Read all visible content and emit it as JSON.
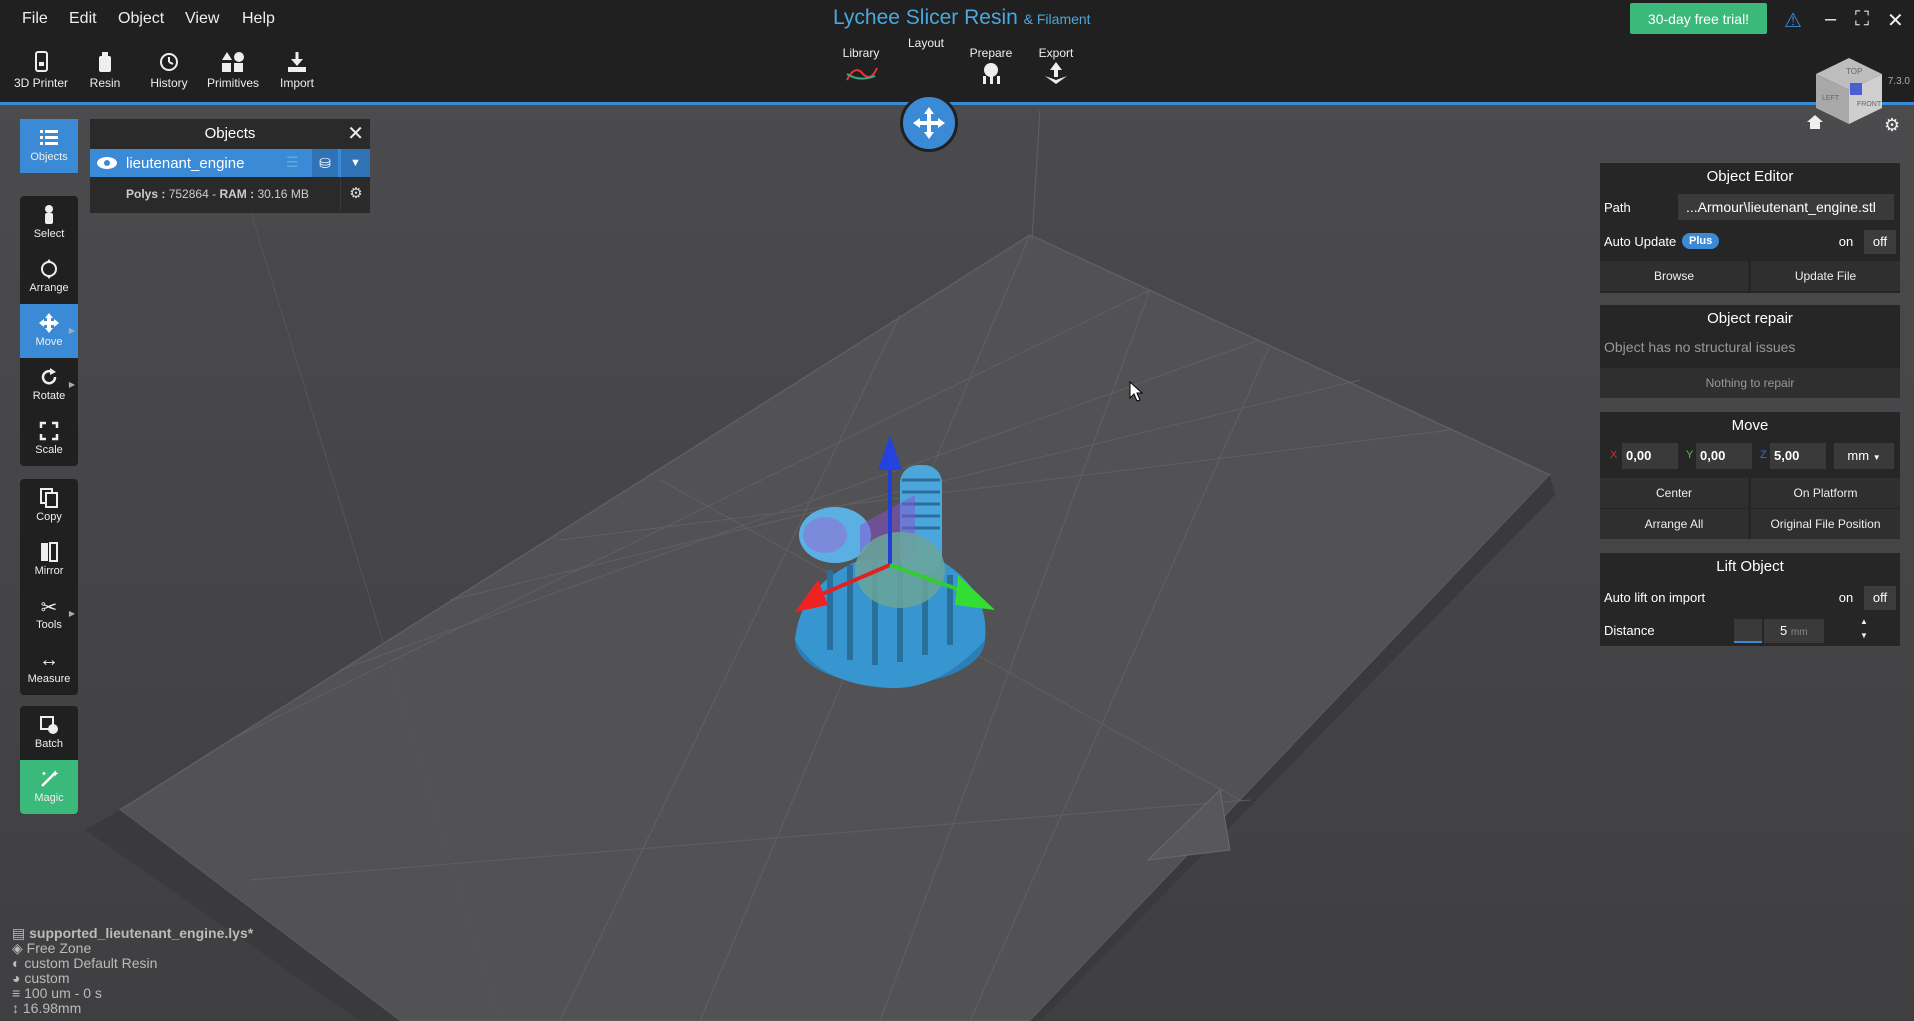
{
  "menu": [
    "File",
    "Edit",
    "Object",
    "View",
    "Help"
  ],
  "app": {
    "title": "Lychee Slicer Resin",
    "subtitle": "& Filament",
    "trial": "30-day free trial!",
    "version": "7.3.0"
  },
  "toolbar_left": [
    {
      "label": "3D Printer",
      "icon": "printer-icon"
    },
    {
      "label": "Resin",
      "icon": "resin-bottle-icon"
    },
    {
      "label": "History",
      "icon": "history-icon"
    },
    {
      "label": "Primitives",
      "icon": "shapes-icon"
    },
    {
      "label": "Import",
      "icon": "import-icon"
    }
  ],
  "workflow_tabs": [
    {
      "label": "Library",
      "icon": "library-icon"
    },
    {
      "label": "Layout",
      "icon": "move-arrows-icon",
      "active": true
    },
    {
      "label": "Prepare",
      "icon": "supports-icon"
    },
    {
      "label": "Export",
      "icon": "export-icon"
    }
  ],
  "view_cube": {
    "top": "TOP",
    "left": "LEFT",
    "front": "FRONT"
  },
  "rail": [
    [
      {
        "label": "Objects",
        "icon": "list-icon",
        "active": true
      }
    ],
    [
      {
        "label": "Select",
        "icon": "pointer-icon"
      },
      {
        "label": "Arrange",
        "icon": "arrange-icon"
      },
      {
        "label": "Move",
        "icon": "move-icon",
        "active": true
      },
      {
        "label": "Rotate",
        "icon": "rotate-icon"
      },
      {
        "label": "Scale",
        "icon": "scale-icon"
      }
    ],
    [
      {
        "label": "Copy",
        "icon": "copy-icon"
      },
      {
        "label": "Mirror",
        "icon": "mirror-icon"
      },
      {
        "label": "Tools",
        "icon": "scissors-icon"
      },
      {
        "label": "Measure",
        "icon": "measure-icon"
      }
    ],
    [
      {
        "label": "Batch",
        "icon": "batch-icon"
      },
      {
        "label": "Magic",
        "icon": "magic-wand-icon"
      }
    ]
  ],
  "objects_panel": {
    "title": "Objects",
    "object_name": "lieutenant_engine",
    "polys_label": "Polys :",
    "polys_value": "752864",
    "sep": "-",
    "ram_label": "RAM :",
    "ram_value": "30.16 MB"
  },
  "object_editor": {
    "title": "Object Editor",
    "path_label": "Path",
    "path_value": "...Armour\\lieutenant_engine.stl",
    "auto_update_label": "Auto Update",
    "plus_badge": "Plus",
    "on": "on",
    "off": "off",
    "browse": "Browse",
    "update_file": "Update File"
  },
  "object_repair": {
    "title": "Object repair",
    "message": "Object has no structural issues",
    "button": "Nothing to repair"
  },
  "move": {
    "title": "Move",
    "x_label": "X",
    "x": "0,00",
    "y_label": "Y",
    "y": "0,00",
    "z_label": "Z",
    "z": "5,00",
    "unit": "mm",
    "center": "Center",
    "on_platform": "On Platform",
    "arrange_all": "Arrange All",
    "original_position": "Original File Position"
  },
  "lift": {
    "title": "Lift Object",
    "auto_lift_label": "Auto lift on import",
    "on": "on",
    "off": "off",
    "distance_label": "Distance",
    "distance_value": "5",
    "distance_unit": "mm"
  },
  "status": {
    "file": "supported_lieutenant_engine.lys*",
    "zone": "Free Zone",
    "resin": "custom Default Resin",
    "profile": "custom",
    "layer": "100 um - 0 s",
    "height": "16.98mm"
  },
  "colors": {
    "accent": "#3a8ad6",
    "trial": "#3bb97a",
    "title": "#4aa8dd",
    "magic": "#3bb97a"
  }
}
